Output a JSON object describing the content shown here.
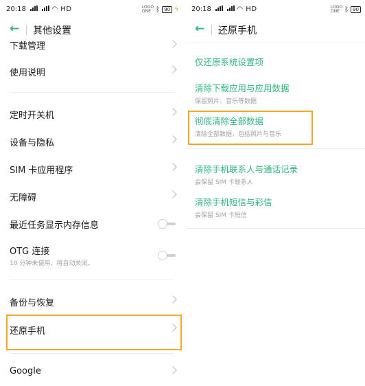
{
  "status_bar": {
    "time": "20:18",
    "network_indicator": "\u0000",
    "net_label": "HD",
    "logo_tag_line1": "LOGO",
    "logo_tag_line2": "ONE",
    "battery": "90",
    "icons": [
      "signal-bars-icon",
      "wifi-icon",
      "bluetooth-icon",
      "battery-icon",
      "charging-bolt-icon"
    ]
  },
  "left": {
    "header": {
      "back_icon": "back-arrow-icon",
      "title": "其他设置"
    },
    "rows": [
      {
        "label": "下载管理",
        "type": "nav"
      },
      {
        "label": "使用说明",
        "type": "nav"
      },
      {
        "label": "定时开关机",
        "type": "nav"
      },
      {
        "label": "设备与隐私",
        "type": "nav"
      },
      {
        "label": "SIM 卡应用程序",
        "type": "nav"
      },
      {
        "label": "无障碍",
        "type": "nav"
      },
      {
        "label": "最近任务显示内存信息",
        "type": "toggle",
        "on": false
      },
      {
        "label": "OTG 连接",
        "sub": "10 分钟未使用，将自动关闭。",
        "type": "toggle",
        "on": false
      },
      {
        "label": "备份与恢复",
        "type": "nav"
      },
      {
        "label": "还原手机",
        "type": "nav",
        "highlighted": true
      },
      {
        "label": "Google",
        "type": "nav"
      }
    ]
  },
  "right": {
    "header": {
      "back_icon": "back-arrow-icon",
      "title": "还原手机"
    },
    "items": [
      {
        "label": "仅还原系统设置项",
        "sub": ""
      },
      {
        "label": "清除下载应用与应用数据",
        "sub": "保留照片、音乐等数据"
      },
      {
        "label": "彻底清除全部数据",
        "sub": "清除全部数据，包括照片与音乐",
        "highlighted": true
      },
      {
        "label": "清除手机联系人与通话记录",
        "sub": "会保留 SIM 卡联系人"
      },
      {
        "label": "清除手机短信与彩信",
        "sub": "会保留 SIM 卡短信"
      }
    ]
  },
  "colors": {
    "accent": "#2eb67d",
    "highlight": "#f5a623",
    "chevron": "#b8b8b8",
    "subtext": "#a0a0a0"
  }
}
